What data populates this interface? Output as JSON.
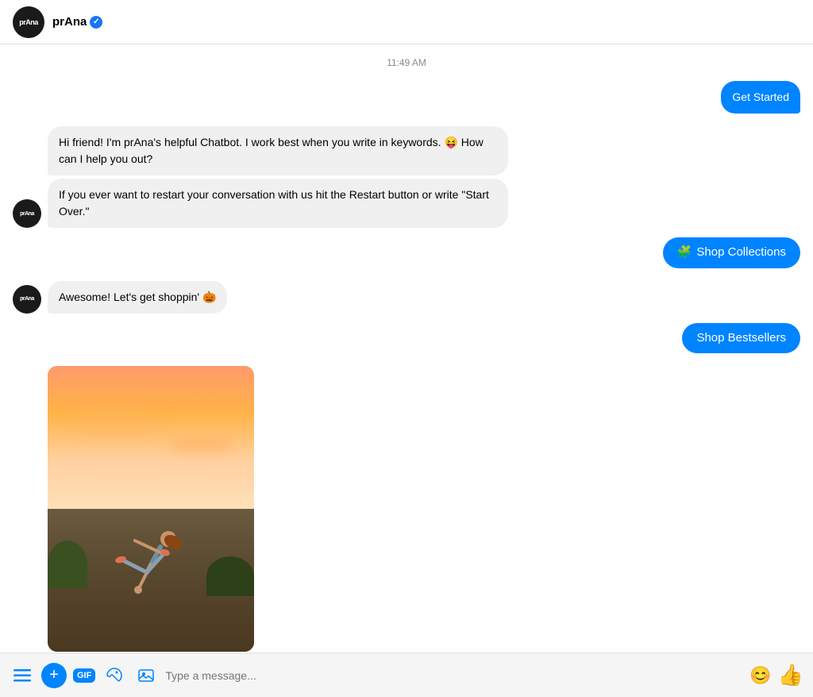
{
  "header": {
    "brand_name": "prAna",
    "verified": true,
    "avatar_text": "prAna"
  },
  "chat": {
    "timestamp": "11:49 AM",
    "messages": [
      {
        "id": "get-started",
        "type": "outgoing",
        "text": "Get Started"
      },
      {
        "id": "bot-msg-1",
        "type": "incoming",
        "text": "Hi friend! I'm prAna's helpful Chatbot. I work best when you write in keywords. 😝 How can I help you out?"
      },
      {
        "id": "bot-msg-2",
        "type": "incoming",
        "text": "If you ever want to restart your conversation with us hit the Restart button or write \"Start Over.\""
      },
      {
        "id": "shop-collections",
        "type": "outgoing",
        "text": "Shop Collections",
        "emoji": "🧩"
      },
      {
        "id": "bot-shoppin",
        "type": "incoming",
        "text": "Awesome! Let's get shoppin' 🎃"
      },
      {
        "id": "shop-bestsellers",
        "type": "outgoing",
        "text": "Shop Bestsellers"
      }
    ]
  },
  "image": {
    "alt": "Yoga acrobatics at sunset"
  },
  "image_actions": {
    "share": "⬆",
    "reply": "↩",
    "more": "···"
  },
  "bottom_bar": {
    "menu_icon": "☰",
    "plus_icon": "+",
    "gif_label": "GIF",
    "sticker_icon": "🏷",
    "gallery_icon": "🖼",
    "input_placeholder": "Type a message...",
    "emoji_icon": "😊",
    "like_icon": "👍"
  }
}
